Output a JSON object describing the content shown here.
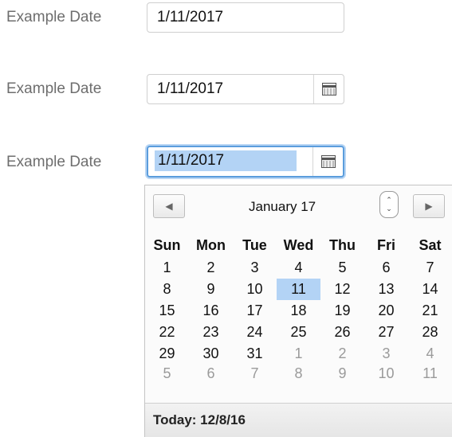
{
  "fields": [
    {
      "label": "Example Date",
      "value": "1/11/2017"
    },
    {
      "label": "Example Date",
      "value": "1/11/2017"
    },
    {
      "label": "Example Date",
      "value": "1/11/2017"
    }
  ],
  "calendar": {
    "month_label": "January 17",
    "prev_glyph": "◀",
    "next_glyph": "▶",
    "weekdays": [
      "Sun",
      "Mon",
      "Tue",
      "Wed",
      "Thu",
      "Fri",
      "Sat"
    ],
    "weeks": [
      [
        "1",
        "2",
        "3",
        "4",
        "5",
        "6",
        "7"
      ],
      [
        "8",
        "9",
        "10",
        "11",
        "12",
        "13",
        "14"
      ],
      [
        "15",
        "16",
        "17",
        "18",
        "19",
        "20",
        "21"
      ],
      [
        "22",
        "23",
        "24",
        "25",
        "26",
        "27",
        "28"
      ],
      [
        "29",
        "30",
        "31",
        "1",
        "2",
        "3",
        "4"
      ],
      [
        "5",
        "6",
        "7",
        "8",
        "9",
        "10",
        "11"
      ]
    ],
    "selected_day": "11",
    "today_label": "Today: 12/8/16"
  }
}
